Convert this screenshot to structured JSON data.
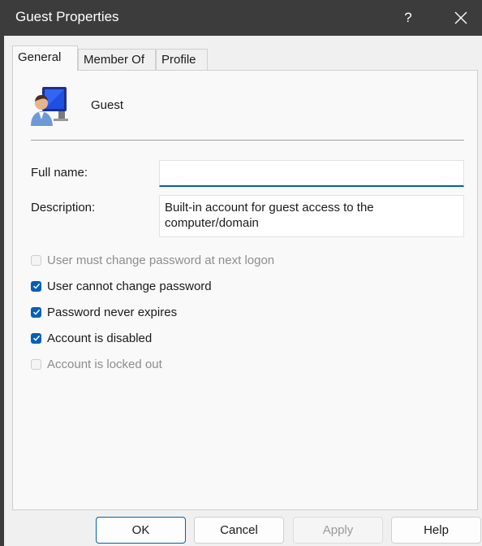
{
  "window": {
    "title": "Guest Properties",
    "help_glyph": "?",
    "close_icon": "close-icon"
  },
  "tabs": [
    {
      "label": "General",
      "active": true
    },
    {
      "label": "Member Of",
      "active": false
    },
    {
      "label": "Profile",
      "active": false
    }
  ],
  "user": {
    "icon": "user-computer-icon",
    "name": "Guest"
  },
  "fields": {
    "full_name_label": "Full name:",
    "full_name_value": "",
    "description_label": "Description:",
    "description_value": "Built-in account for guest access to the computer/domain"
  },
  "options": [
    {
      "label": "User must change password at next logon",
      "checked": false,
      "enabled": false
    },
    {
      "label": "User cannot change password",
      "checked": true,
      "enabled": true
    },
    {
      "label": "Password never expires",
      "checked": true,
      "enabled": true
    },
    {
      "label": "Account is disabled",
      "checked": true,
      "enabled": true
    },
    {
      "label": "Account is locked out",
      "checked": false,
      "enabled": false
    }
  ],
  "buttons": {
    "ok": "OK",
    "cancel": "Cancel",
    "apply": "Apply",
    "help": "Help"
  },
  "colors": {
    "titlebar": "#3c3c3c",
    "accent": "#005fb8"
  }
}
